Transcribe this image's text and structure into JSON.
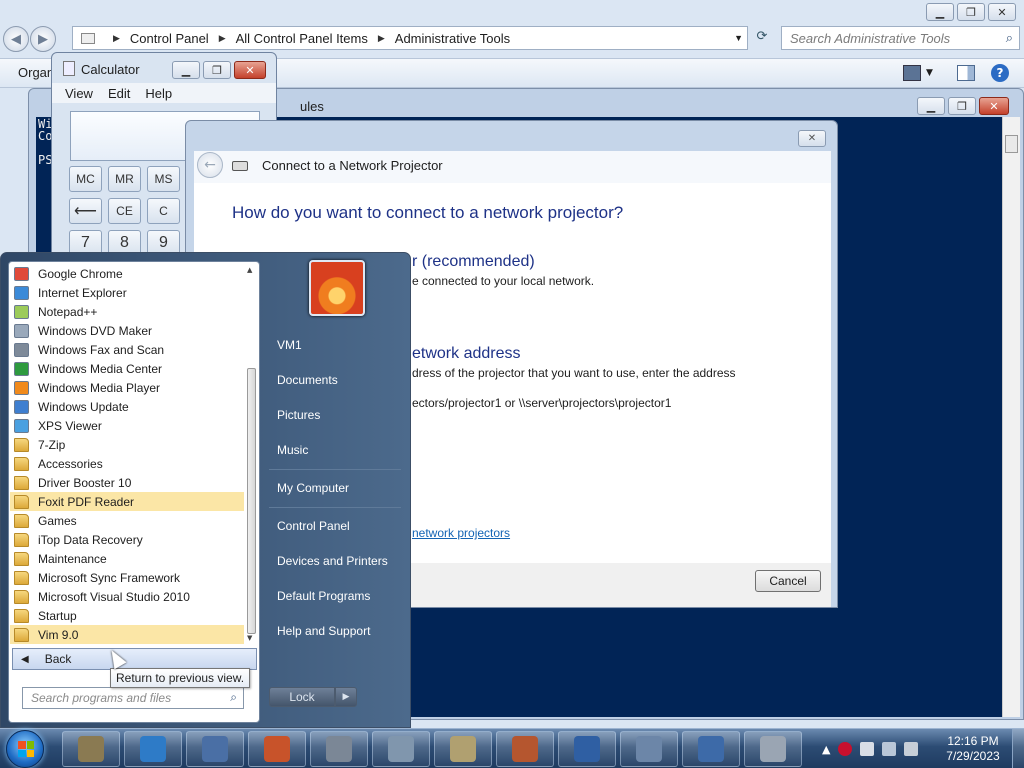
{
  "explorer": {
    "breadcrumb": [
      "Control Panel",
      "All Control Panel Items",
      "Administrative Tools"
    ],
    "search_placeholder": "Search Administrative Tools",
    "toolbar_organize": "Organ"
  },
  "powershell": {
    "title_fragment": "ules",
    "console_lines": [
      "Wi",
      "Co",
      "",
      "PS"
    ]
  },
  "calculator": {
    "title": "Calculator",
    "menu": [
      "View",
      "Edit",
      "Help"
    ],
    "memory_buttons": [
      "MC",
      "MR",
      "MS"
    ],
    "edit_buttons": [
      "⟵",
      "CE",
      "C"
    ],
    "digit_buttons": [
      "7",
      "8",
      "9"
    ]
  },
  "projector_dialog": {
    "title": "Connect to a Network Projector",
    "question": "How do you want to connect to a network projector?",
    "option1_title": "r (recommended)",
    "option1_desc": "e connected to your local network.",
    "option2_title": "etwork address",
    "option2_desc": "dress of the projector that you want to use, enter the address",
    "option2_example": "ectors/projector1 or \\\\server\\projectors\\projector1",
    "link_fragment": "network projectors",
    "cancel_label": "Cancel"
  },
  "start_menu": {
    "programs": [
      {
        "label": "Google Chrome",
        "icon": "chrome-icon",
        "color": "#e04a3a",
        "kind": "app",
        "highlight": false
      },
      {
        "label": "Internet Explorer",
        "icon": "ie-icon",
        "color": "#3b8ad8",
        "kind": "app",
        "highlight": false
      },
      {
        "label": "Notepad++",
        "icon": "notepad-plus-icon",
        "color": "#9ccb5a",
        "kind": "app",
        "highlight": false
      },
      {
        "label": "Windows DVD Maker",
        "icon": "dvd-icon",
        "color": "#9aa9bb",
        "kind": "app",
        "highlight": false
      },
      {
        "label": "Windows Fax and Scan",
        "icon": "fax-icon",
        "color": "#7e8a99",
        "kind": "app",
        "highlight": false
      },
      {
        "label": "Windows Media Center",
        "icon": "media-center-icon",
        "color": "#2e9a3f",
        "kind": "app",
        "highlight": false
      },
      {
        "label": "Windows Media Player",
        "icon": "media-player-icon",
        "color": "#f08a1c",
        "kind": "app",
        "highlight": false
      },
      {
        "label": "Windows Update",
        "icon": "windows-update-icon",
        "color": "#3f7fd0",
        "kind": "app",
        "highlight": false
      },
      {
        "label": "XPS Viewer",
        "icon": "xps-icon",
        "color": "#4aa0e0",
        "kind": "app",
        "highlight": false
      },
      {
        "label": "7-Zip",
        "icon": "folder-icon",
        "color": "#e7bb4f",
        "kind": "folder",
        "highlight": false
      },
      {
        "label": "Accessories",
        "icon": "folder-icon",
        "color": "#e7bb4f",
        "kind": "folder",
        "highlight": false
      },
      {
        "label": "Driver Booster 10",
        "icon": "folder-icon",
        "color": "#e7bb4f",
        "kind": "folder",
        "highlight": false
      },
      {
        "label": "Foxit PDF Reader",
        "icon": "folder-icon",
        "color": "#e7bb4f",
        "kind": "folder",
        "highlight": true
      },
      {
        "label": "Games",
        "icon": "folder-icon",
        "color": "#e7bb4f",
        "kind": "folder",
        "highlight": false
      },
      {
        "label": "iTop Data Recovery",
        "icon": "folder-icon",
        "color": "#e7bb4f",
        "kind": "folder",
        "highlight": false
      },
      {
        "label": "Maintenance",
        "icon": "folder-icon",
        "color": "#e7bb4f",
        "kind": "folder",
        "highlight": false
      },
      {
        "label": "Microsoft Sync Framework",
        "icon": "folder-icon",
        "color": "#e7bb4f",
        "kind": "folder",
        "highlight": false
      },
      {
        "label": "Microsoft Visual Studio 2010",
        "icon": "folder-icon",
        "color": "#e7bb4f",
        "kind": "folder",
        "highlight": false
      },
      {
        "label": "Startup",
        "icon": "folder-icon",
        "color": "#e7bb4f",
        "kind": "folder",
        "highlight": false
      },
      {
        "label": "Vim 9.0",
        "icon": "folder-icon",
        "color": "#e7bb4f",
        "kind": "folder",
        "highlight": true
      }
    ],
    "back_label": "Back",
    "back_tooltip": "Return to previous view.",
    "search_placeholder": "Search programs and files",
    "right_items": [
      "VM1",
      "Documents",
      "Pictures",
      "Music",
      "My Computer",
      "Control Panel",
      "Devices and Printers",
      "Default Programs",
      "Help and Support"
    ],
    "lock_label": "Lock"
  },
  "taskbar": {
    "apps": [
      {
        "name": "server-manager-icon",
        "color": "#8a7a52"
      },
      {
        "name": "network-globe-icon",
        "color": "#2e7bc7"
      },
      {
        "name": "remote-desktop-icon",
        "color": "#4a6fa5"
      },
      {
        "name": "performance-gauge-icon",
        "color": "#c8532a"
      },
      {
        "name": "tools-icon",
        "color": "#7b8796"
      },
      {
        "name": "gears-icon",
        "color": "#8096ad"
      },
      {
        "name": "clock-icon",
        "color": "#b0a070"
      },
      {
        "name": "firewall-icon",
        "color": "#b5562f"
      },
      {
        "name": "powershell-icon",
        "color": "#2f5fa3"
      },
      {
        "name": "calculator-icon",
        "color": "#6c86a8"
      },
      {
        "name": "network-projector-icon",
        "color": "#3d6aa8"
      },
      {
        "name": "projector-icon",
        "color": "#9aa5b3"
      }
    ],
    "time": "12:16 PM",
    "date": "7/29/2023"
  }
}
